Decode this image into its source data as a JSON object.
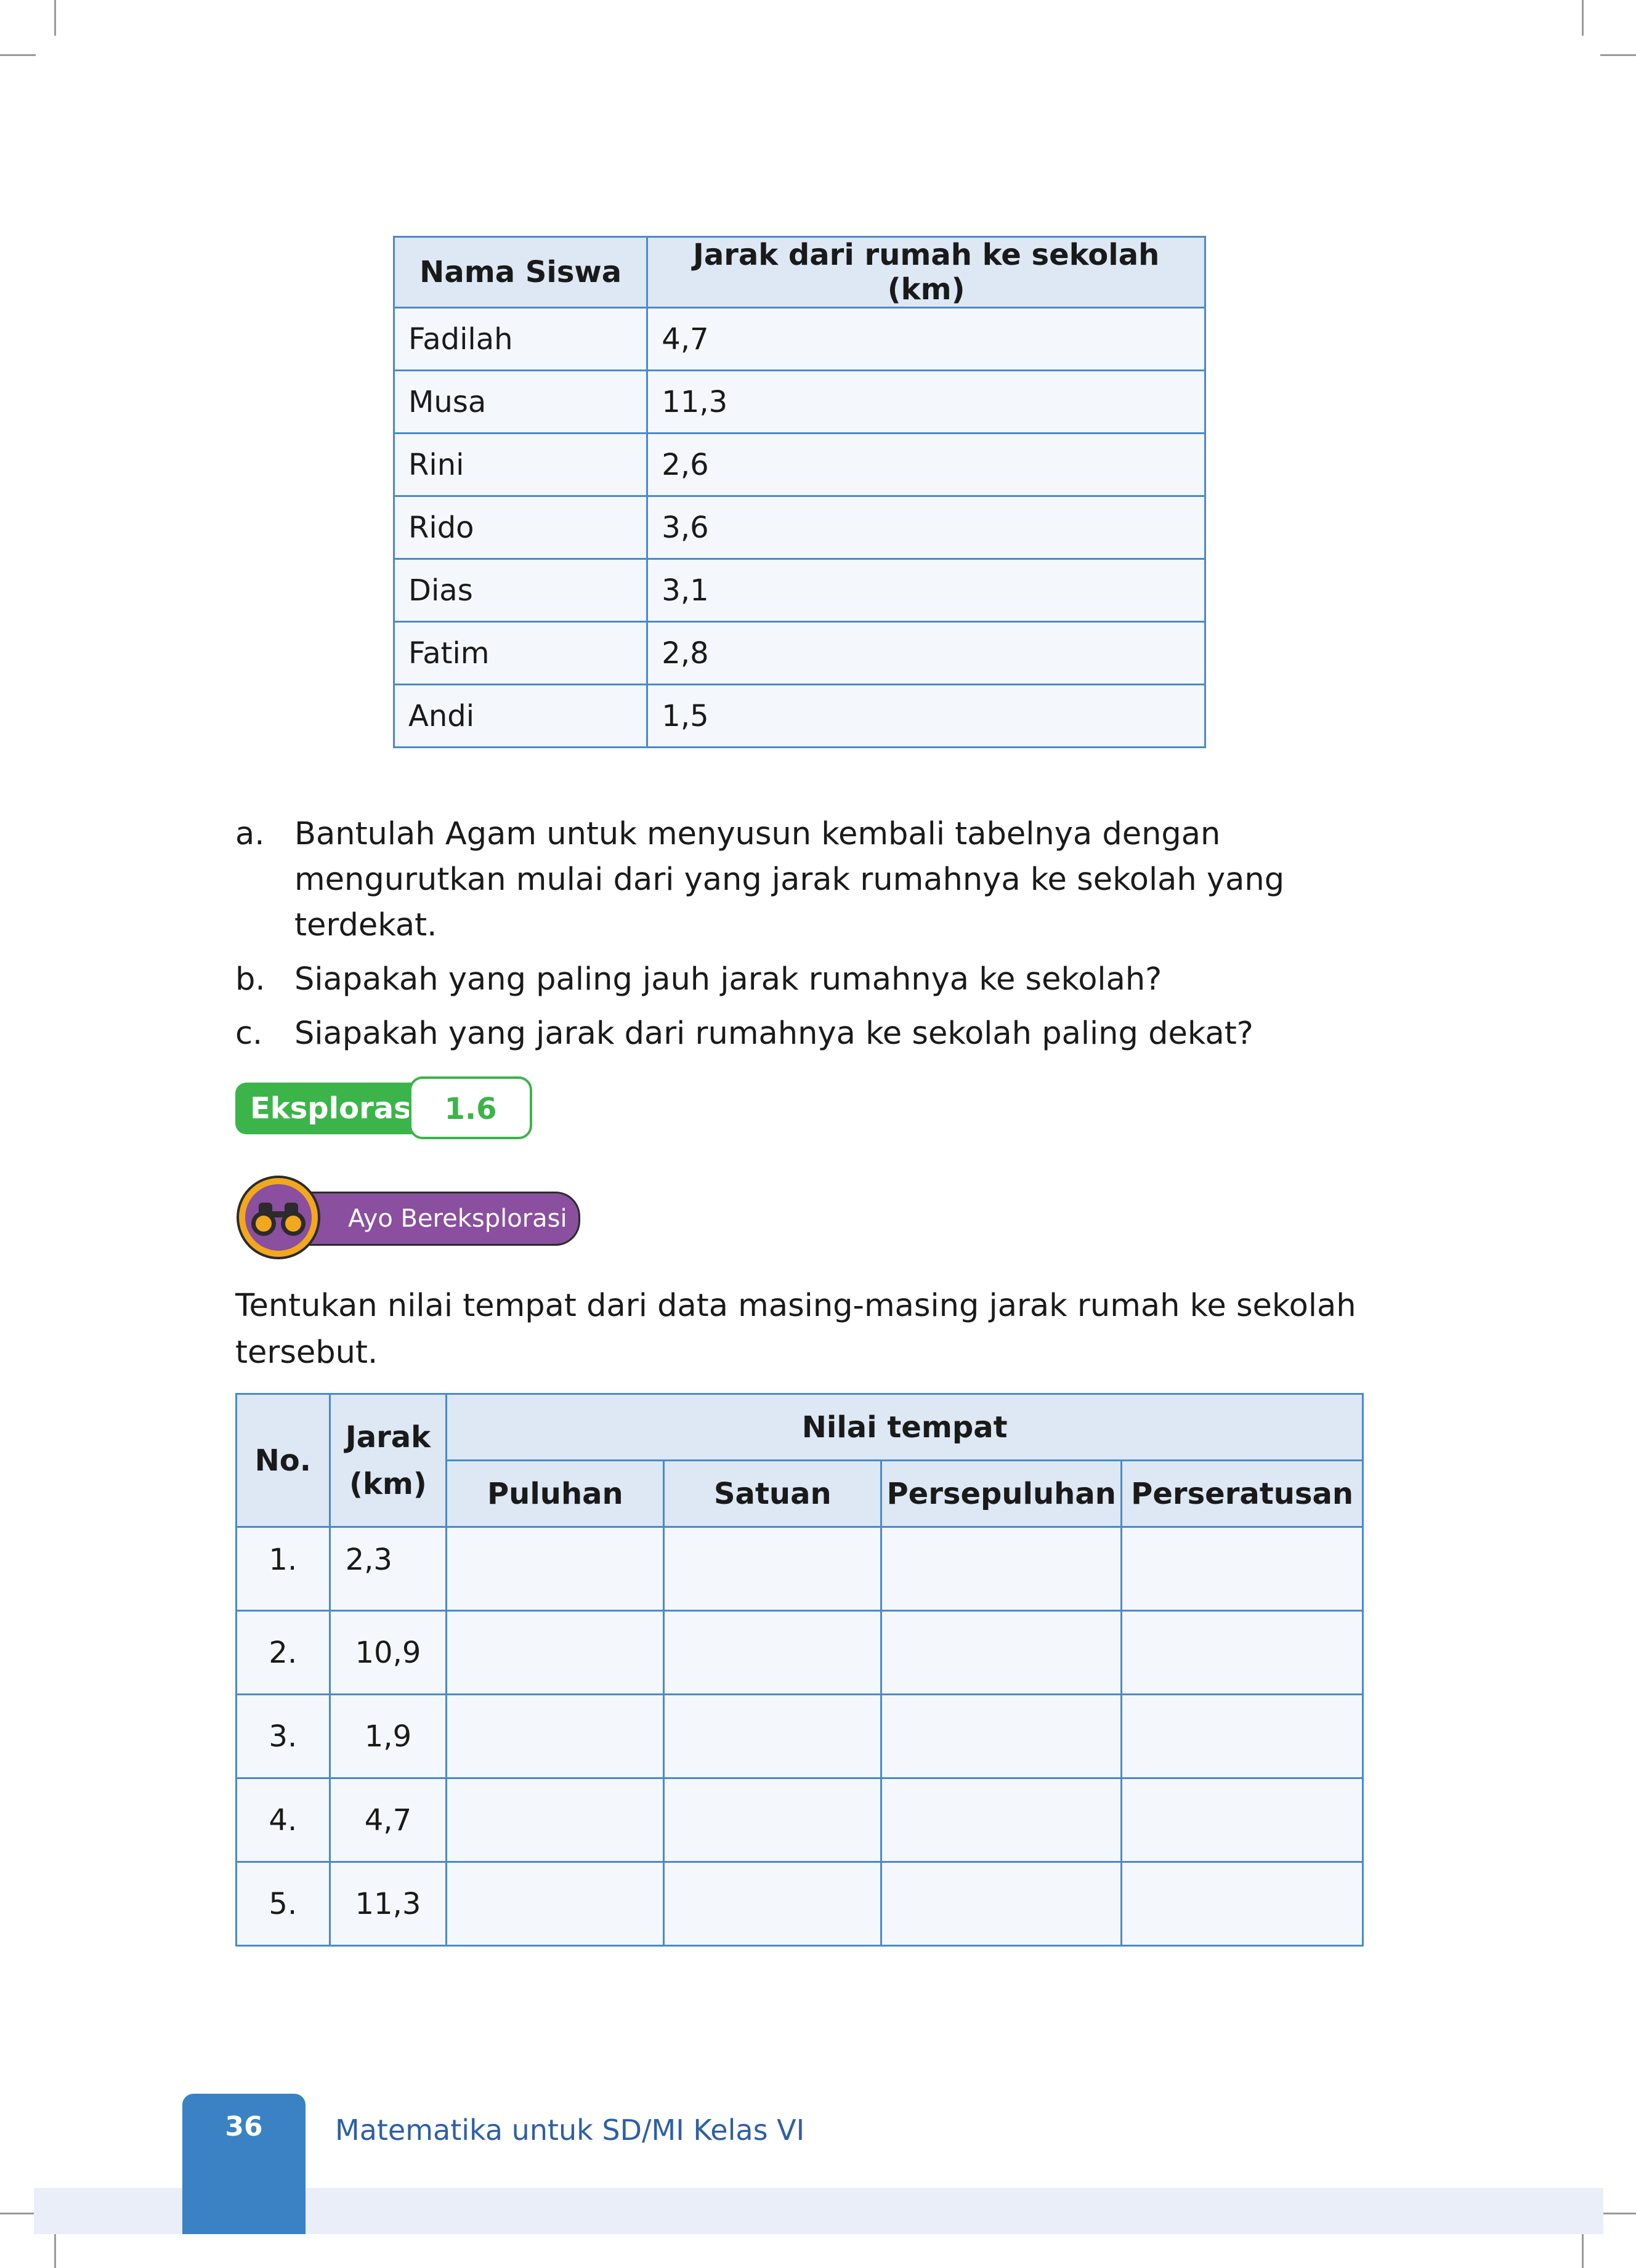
{
  "table1": {
    "headers": [
      "Nama Siswa",
      "Jarak dari rumah ke sekolah (km)"
    ],
    "rows": [
      [
        "Fadilah",
        "4,7"
      ],
      [
        "Musa",
        "11,3"
      ],
      [
        "Rini",
        "2,6"
      ],
      [
        "Rido",
        "3,6"
      ],
      [
        "Dias",
        "3,1"
      ],
      [
        "Fatim",
        "2,8"
      ],
      [
        "Andi",
        "1,5"
      ]
    ]
  },
  "questions": [
    {
      "letter": "a.",
      "text": "Bantulah Agam untuk menyusun kembali tabelnya dengan mengurutkan mulai dari yang jarak rumahnya ke sekolah yang terdekat."
    },
    {
      "letter": "b.",
      "text": "Siapakah yang paling jauh jarak rumahnya ke sekolah?"
    },
    {
      "letter": "c.",
      "text": "Siapakah yang jarak dari rumahnya ke sekolah paling dekat?"
    }
  ],
  "eksplorasi": {
    "label": "Eksplorasi",
    "number": "1.6"
  },
  "ayo": {
    "label": "Ayo Bereksplorasi",
    "icon": "binoculars-icon"
  },
  "paragraph": "Tentukan nilai tempat dari data masing-masing jarak rumah ke sekolah tersebut.",
  "table2": {
    "header_no": "No.",
    "header_jarak": "Jarak (km)",
    "header_nilai": "Nilai tempat",
    "subheaders": [
      "Puluhan",
      "Satuan",
      "Persepuluhan",
      "Perseratusan"
    ],
    "rows": [
      {
        "no": "1.",
        "jarak": "2,3"
      },
      {
        "no": "2.",
        "jarak": "10,9"
      },
      {
        "no": "3.",
        "jarak": "1,9"
      },
      {
        "no": "4.",
        "jarak": "4,7"
      },
      {
        "no": "5.",
        "jarak": "11,3"
      }
    ]
  },
  "footer": {
    "page_number": "36",
    "book_title": "Matematika untuk SD/MI Kelas VI"
  },
  "colors": {
    "table_border": "#4a8ac9",
    "eksplorasi_green": "#3bb54a",
    "ayo_purple": "#8a4f9e",
    "page_tab_blue": "#3a82c4"
  }
}
